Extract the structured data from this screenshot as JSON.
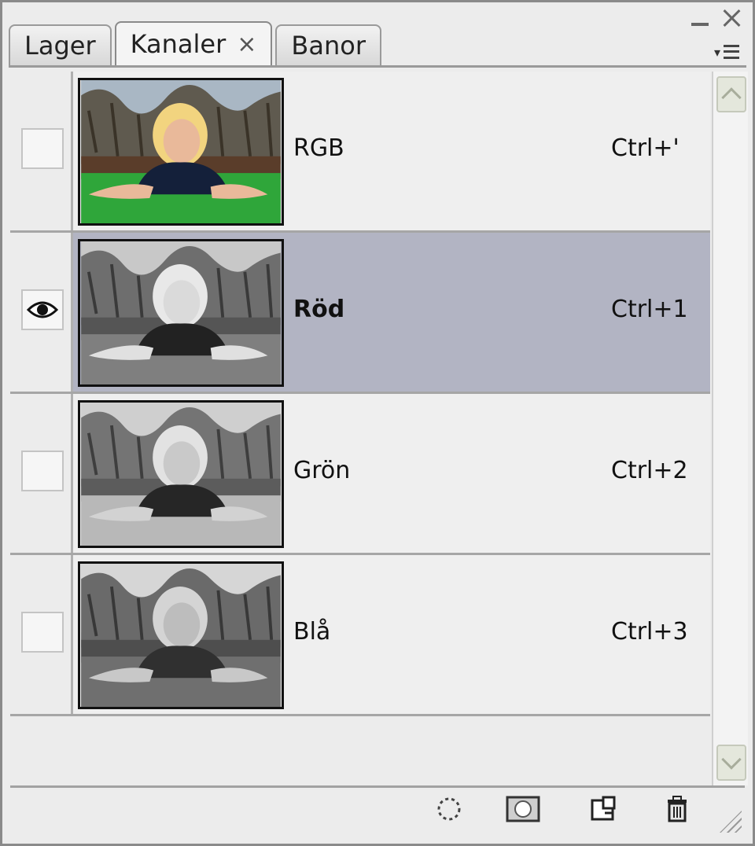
{
  "window": {
    "controls": {
      "minimize_icon": "minimize-icon",
      "close_icon": "close-icon"
    }
  },
  "tabs": [
    {
      "label": "Lager",
      "active": false
    },
    {
      "label": "Kanaler",
      "active": true,
      "close_glyph": "×"
    },
    {
      "label": "Banor",
      "active": false
    }
  ],
  "panel_menu_icon": "panel-menu-icon",
  "channels": [
    {
      "name": "RGB",
      "shortcut": "Ctrl+'",
      "visible": false,
      "selected": false,
      "thumb": "color"
    },
    {
      "name": "Röd",
      "shortcut": "Ctrl+1",
      "visible": true,
      "selected": true,
      "thumb": "gray"
    },
    {
      "name": "Grön",
      "shortcut": "Ctrl+2",
      "visible": false,
      "selected": false,
      "thumb": "gray"
    },
    {
      "name": "Blå",
      "shortcut": "Ctrl+3",
      "visible": false,
      "selected": false,
      "thumb": "gray"
    }
  ],
  "footer_buttons": [
    {
      "icon": "load-selection-icon"
    },
    {
      "icon": "save-mask-icon"
    },
    {
      "icon": "new-channel-icon"
    },
    {
      "icon": "trash-icon"
    }
  ],
  "colors": {
    "selected_row": "#b2b4c3",
    "panel_bg": "#ececec",
    "grass": "#2fa63a"
  }
}
